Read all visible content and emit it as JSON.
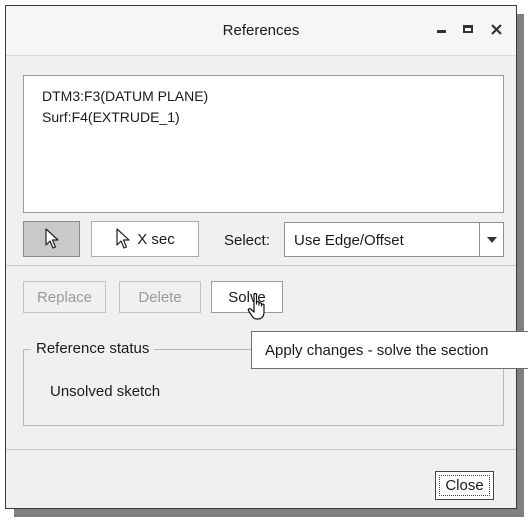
{
  "window": {
    "title": "References"
  },
  "references": [
    "DTM3:F3(DATUM PLANE)",
    "Surf:F4(EXTRUDE_1)"
  ],
  "selection": {
    "xsec_label": "X sec",
    "select_label": "Select:",
    "select_value": "Use Edge/Offset"
  },
  "actions": {
    "replace": "Replace",
    "delete": "Delete",
    "solve": "Solve"
  },
  "status": {
    "legend": "Reference status",
    "text": "Unsolved sketch"
  },
  "tooltip": {
    "text": "Apply changes - solve the section"
  },
  "footer": {
    "close": "Close"
  }
}
